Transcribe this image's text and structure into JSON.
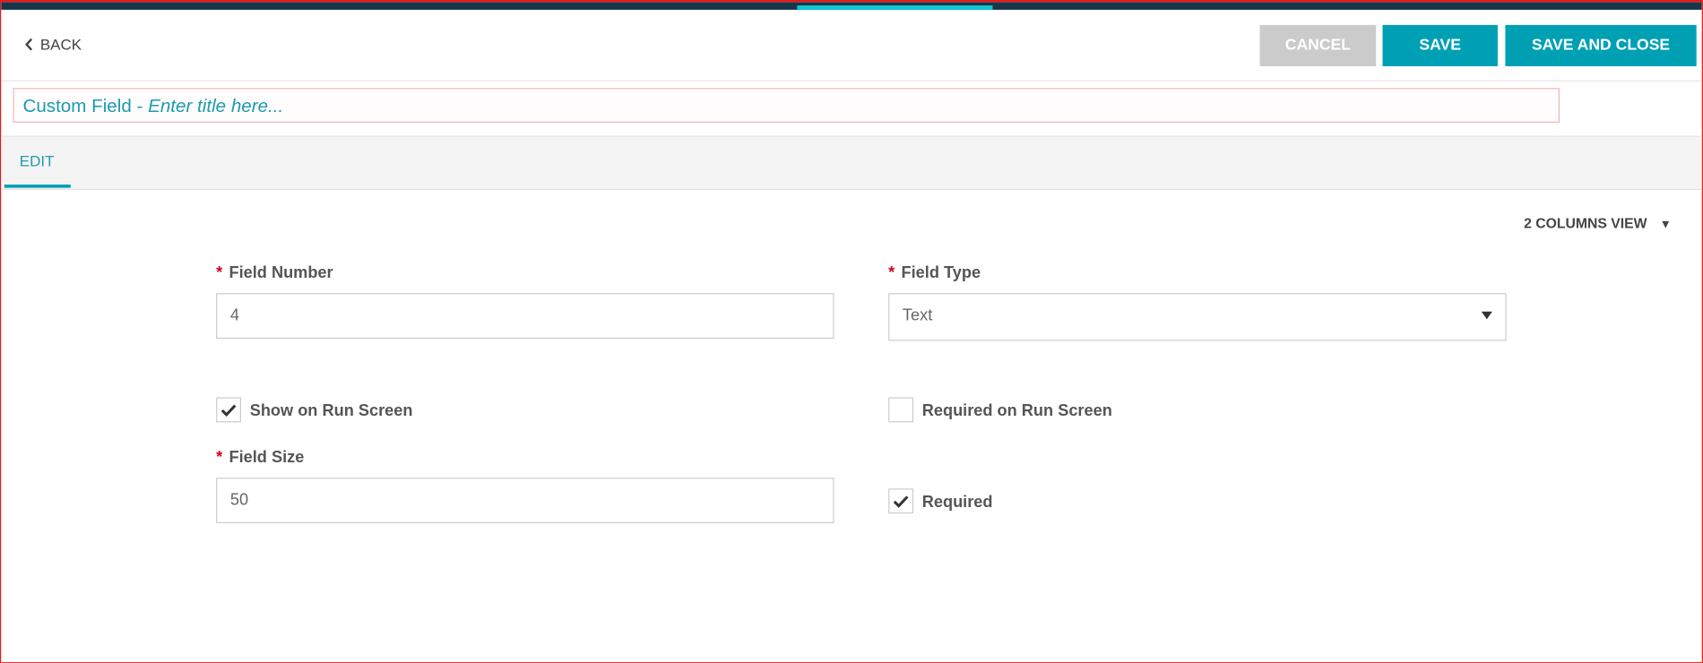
{
  "header": {
    "back_label": "BACK",
    "cancel_label": "CANCEL",
    "save_label": "SAVE",
    "save_close_label": "SAVE AND CLOSE"
  },
  "title": {
    "prefix": "Custom Field - ",
    "placeholder": "Enter title here..."
  },
  "tabs": [
    {
      "label": "EDIT",
      "active": true
    }
  ],
  "view_selector": {
    "label": "2 COLUMNS VIEW"
  },
  "form": {
    "field_number": {
      "label": "Field Number",
      "value": "4",
      "required": true
    },
    "field_type": {
      "label": "Field Type",
      "value": "Text",
      "required": true
    },
    "show_on_run_screen": {
      "label": "Show on Run Screen",
      "checked": true
    },
    "required_on_run_screen": {
      "label": "Required on Run Screen",
      "checked": false
    },
    "field_size": {
      "label": "Field Size",
      "value": "50",
      "required": true
    },
    "required": {
      "label": "Required",
      "checked": true
    },
    "required_marker": "*"
  },
  "colors": {
    "accent": "#00a0b4",
    "topbar": "#17364a",
    "required": "#d0021b"
  }
}
